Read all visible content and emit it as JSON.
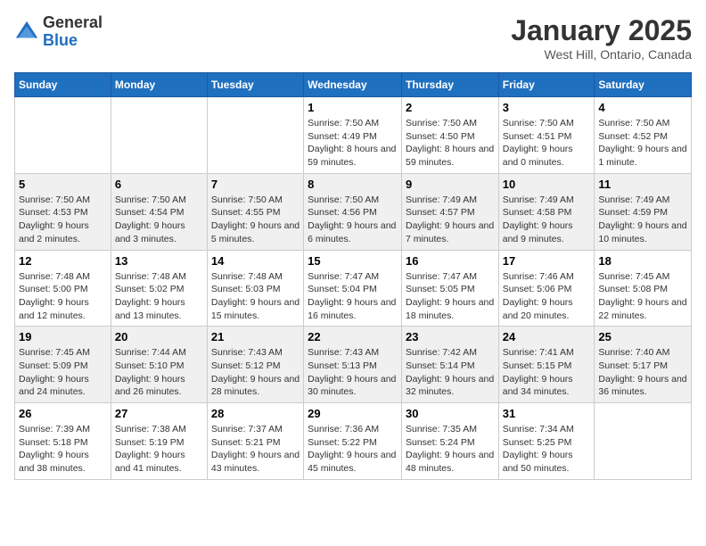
{
  "header": {
    "logo_general": "General",
    "logo_blue": "Blue",
    "month_title": "January 2025",
    "location": "West Hill, Ontario, Canada"
  },
  "weekdays": [
    "Sunday",
    "Monday",
    "Tuesday",
    "Wednesday",
    "Thursday",
    "Friday",
    "Saturday"
  ],
  "weeks": [
    [
      {
        "day": "",
        "info": ""
      },
      {
        "day": "",
        "info": ""
      },
      {
        "day": "",
        "info": ""
      },
      {
        "day": "1",
        "info": "Sunrise: 7:50 AM\nSunset: 4:49 PM\nDaylight: 8 hours and 59 minutes."
      },
      {
        "day": "2",
        "info": "Sunrise: 7:50 AM\nSunset: 4:50 PM\nDaylight: 8 hours and 59 minutes."
      },
      {
        "day": "3",
        "info": "Sunrise: 7:50 AM\nSunset: 4:51 PM\nDaylight: 9 hours and 0 minutes."
      },
      {
        "day": "4",
        "info": "Sunrise: 7:50 AM\nSunset: 4:52 PM\nDaylight: 9 hours and 1 minute."
      }
    ],
    [
      {
        "day": "5",
        "info": "Sunrise: 7:50 AM\nSunset: 4:53 PM\nDaylight: 9 hours and 2 minutes."
      },
      {
        "day": "6",
        "info": "Sunrise: 7:50 AM\nSunset: 4:54 PM\nDaylight: 9 hours and 3 minutes."
      },
      {
        "day": "7",
        "info": "Sunrise: 7:50 AM\nSunset: 4:55 PM\nDaylight: 9 hours and 5 minutes."
      },
      {
        "day": "8",
        "info": "Sunrise: 7:50 AM\nSunset: 4:56 PM\nDaylight: 9 hours and 6 minutes."
      },
      {
        "day": "9",
        "info": "Sunrise: 7:49 AM\nSunset: 4:57 PM\nDaylight: 9 hours and 7 minutes."
      },
      {
        "day": "10",
        "info": "Sunrise: 7:49 AM\nSunset: 4:58 PM\nDaylight: 9 hours and 9 minutes."
      },
      {
        "day": "11",
        "info": "Sunrise: 7:49 AM\nSunset: 4:59 PM\nDaylight: 9 hours and 10 minutes."
      }
    ],
    [
      {
        "day": "12",
        "info": "Sunrise: 7:48 AM\nSunset: 5:00 PM\nDaylight: 9 hours and 12 minutes."
      },
      {
        "day": "13",
        "info": "Sunrise: 7:48 AM\nSunset: 5:02 PM\nDaylight: 9 hours and 13 minutes."
      },
      {
        "day": "14",
        "info": "Sunrise: 7:48 AM\nSunset: 5:03 PM\nDaylight: 9 hours and 15 minutes."
      },
      {
        "day": "15",
        "info": "Sunrise: 7:47 AM\nSunset: 5:04 PM\nDaylight: 9 hours and 16 minutes."
      },
      {
        "day": "16",
        "info": "Sunrise: 7:47 AM\nSunset: 5:05 PM\nDaylight: 9 hours and 18 minutes."
      },
      {
        "day": "17",
        "info": "Sunrise: 7:46 AM\nSunset: 5:06 PM\nDaylight: 9 hours and 20 minutes."
      },
      {
        "day": "18",
        "info": "Sunrise: 7:45 AM\nSunset: 5:08 PM\nDaylight: 9 hours and 22 minutes."
      }
    ],
    [
      {
        "day": "19",
        "info": "Sunrise: 7:45 AM\nSunset: 5:09 PM\nDaylight: 9 hours and 24 minutes."
      },
      {
        "day": "20",
        "info": "Sunrise: 7:44 AM\nSunset: 5:10 PM\nDaylight: 9 hours and 26 minutes."
      },
      {
        "day": "21",
        "info": "Sunrise: 7:43 AM\nSunset: 5:12 PM\nDaylight: 9 hours and 28 minutes."
      },
      {
        "day": "22",
        "info": "Sunrise: 7:43 AM\nSunset: 5:13 PM\nDaylight: 9 hours and 30 minutes."
      },
      {
        "day": "23",
        "info": "Sunrise: 7:42 AM\nSunset: 5:14 PM\nDaylight: 9 hours and 32 minutes."
      },
      {
        "day": "24",
        "info": "Sunrise: 7:41 AM\nSunset: 5:15 PM\nDaylight: 9 hours and 34 minutes."
      },
      {
        "day": "25",
        "info": "Sunrise: 7:40 AM\nSunset: 5:17 PM\nDaylight: 9 hours and 36 minutes."
      }
    ],
    [
      {
        "day": "26",
        "info": "Sunrise: 7:39 AM\nSunset: 5:18 PM\nDaylight: 9 hours and 38 minutes."
      },
      {
        "day": "27",
        "info": "Sunrise: 7:38 AM\nSunset: 5:19 PM\nDaylight: 9 hours and 41 minutes."
      },
      {
        "day": "28",
        "info": "Sunrise: 7:37 AM\nSunset: 5:21 PM\nDaylight: 9 hours and 43 minutes."
      },
      {
        "day": "29",
        "info": "Sunrise: 7:36 AM\nSunset: 5:22 PM\nDaylight: 9 hours and 45 minutes."
      },
      {
        "day": "30",
        "info": "Sunrise: 7:35 AM\nSunset: 5:24 PM\nDaylight: 9 hours and 48 minutes."
      },
      {
        "day": "31",
        "info": "Sunrise: 7:34 AM\nSunset: 5:25 PM\nDaylight: 9 hours and 50 minutes."
      },
      {
        "day": "",
        "info": ""
      }
    ]
  ]
}
